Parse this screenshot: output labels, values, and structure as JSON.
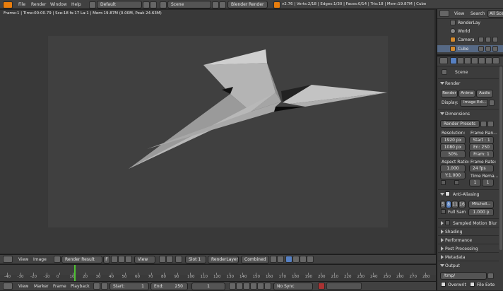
{
  "top": {
    "menu": [
      "File",
      "Render",
      "Window",
      "Help"
    ],
    "layout": "Default",
    "scene": "Scene",
    "engine": "Blender Render",
    "stats": "v2.76 | Verts:2/18 | Edges:1/30 | Faces:0/14 | Tris:18 | Mem:19.87M | Cube"
  },
  "viewport": {
    "info": "Frame:1 | Time:00:00.79 | Sce:18 fs:17 La:1 | Mem:19.87M (0.00M, Peak 24.63M)"
  },
  "image_header": {
    "view": "View",
    "image": "Image",
    "image_name": "Render Result",
    "fake_user": "F",
    "view_menu": "View",
    "slot": "Slot 1",
    "layer": "RenderLayer",
    "pass": "Combined"
  },
  "timeline": {
    "ruler": [
      "-40",
      "-30",
      "-20",
      "-10",
      "0",
      "10",
      "20",
      "30",
      "40",
      "50",
      "60",
      "70",
      "80",
      "90",
      "100",
      "110",
      "120",
      "130",
      "140",
      "150",
      "160",
      "170",
      "180",
      "190",
      "200",
      "210",
      "220",
      "230",
      "240",
      "250",
      "260",
      "270",
      "280"
    ],
    "menu": [
      "View",
      "Marker",
      "Frame",
      "Playback"
    ],
    "start": "Start:",
    "start_val": "1",
    "end": "End:",
    "end_val": "250",
    "current": "1",
    "sync": "No Sync"
  },
  "outliner": {
    "view": "View",
    "search": "Search",
    "all_scenes": "All Sce",
    "items": [
      "RenderLay",
      "World",
      "Camera",
      "Cube"
    ]
  },
  "properties": {
    "scene": "Scene",
    "render": "Render",
    "render_btn": "Render",
    "anim_btn": "Anima",
    "audio_btn": "Audio",
    "display_label": "Display:",
    "display_val": "Image Edi...",
    "dimensions": "Dimensions",
    "presets": "Render Presets",
    "resolution": "Resolution:",
    "res_x": "1920 px",
    "res_y": "1080 px",
    "res_pct": "50%",
    "frame_range": "Frame Ran...",
    "start": "Start : 1",
    "end": "En: 250",
    "step": "Fram: 1",
    "aspect": "Aspect Ratio:",
    "aspect_x": "1.000",
    "aspect_y": "Y:1.000",
    "frame_rate": "Frame Rate:",
    "fps": "24 fps",
    "time_remap": "Time Rema...",
    "remap_old": "1",
    "remap_new": "1",
    "anti_aliasing": "Anti-Aliasing",
    "aa_samples": [
      "5",
      "8",
      "11",
      "16"
    ],
    "aa_filter": "Mitchell...",
    "full_sample": "Full Sam",
    "filter_size": "1.000 p",
    "sections": [
      "Sampled Motion Blur",
      "Shading",
      "Performance",
      "Post Processing",
      "Metadata",
      "Output"
    ],
    "output_path": "/tmp/",
    "overwrite": "Overwrit",
    "file_ext": "File Exte"
  }
}
